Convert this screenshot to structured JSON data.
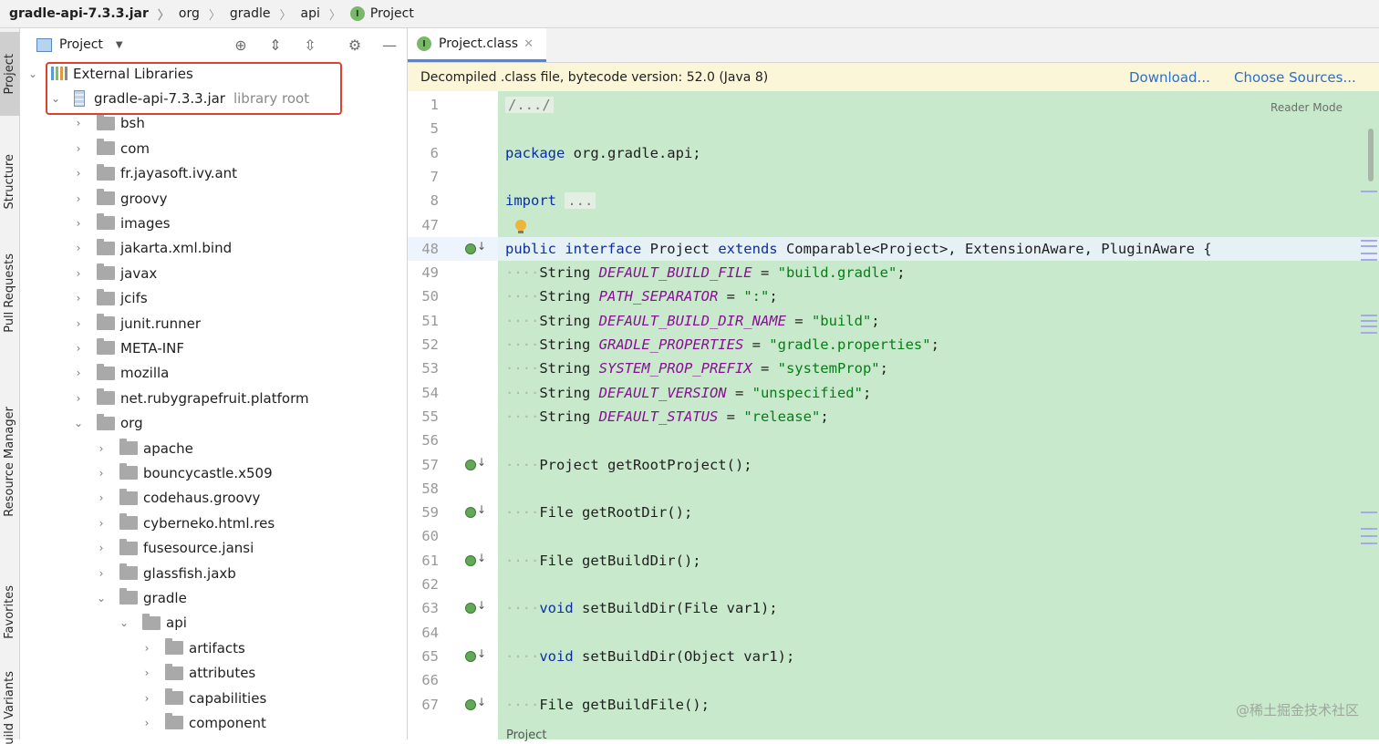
{
  "breadcrumb": [
    "gradle-api-7.3.3.jar",
    "org",
    "gradle",
    "api",
    "Project"
  ],
  "strip_tabs": [
    "Project",
    "Structure",
    "Pull Requests",
    "Resource Manager",
    "Favorites",
    "uild Variants"
  ],
  "panel": {
    "title": "Project",
    "tools": [
      "target-icon",
      "expand-all-icon",
      "collapse-all-icon",
      "gear-icon",
      "minimize-icon"
    ]
  },
  "tree": [
    {
      "label": "External Libraries",
      "depth": 0,
      "icon": "library",
      "expanded": true
    },
    {
      "label": "gradle-api-7.3.3.jar",
      "suffix": "library root",
      "depth": 1,
      "icon": "jar",
      "expanded": true
    },
    {
      "label": "bsh",
      "depth": 2,
      "icon": "folder",
      "expanded": false
    },
    {
      "label": "com",
      "depth": 2,
      "icon": "folder",
      "expanded": false
    },
    {
      "label": "fr.jayasoft.ivy.ant",
      "depth": 2,
      "icon": "folder",
      "expanded": false
    },
    {
      "label": "groovy",
      "depth": 2,
      "icon": "folder",
      "expanded": false
    },
    {
      "label": "images",
      "depth": 2,
      "icon": "folder",
      "expanded": false
    },
    {
      "label": "jakarta.xml.bind",
      "depth": 2,
      "icon": "folder",
      "expanded": false
    },
    {
      "label": "javax",
      "depth": 2,
      "icon": "folder",
      "expanded": false
    },
    {
      "label": "jcifs",
      "depth": 2,
      "icon": "folder",
      "expanded": false
    },
    {
      "label": "junit.runner",
      "depth": 2,
      "icon": "folder",
      "expanded": false
    },
    {
      "label": "META-INF",
      "depth": 2,
      "icon": "folder",
      "expanded": false
    },
    {
      "label": "mozilla",
      "depth": 2,
      "icon": "folder",
      "expanded": false
    },
    {
      "label": "net.rubygrapefruit.platform",
      "depth": 2,
      "icon": "folder",
      "expanded": false
    },
    {
      "label": "org",
      "depth": 2,
      "icon": "folder",
      "expanded": true
    },
    {
      "label": "apache",
      "depth": 3,
      "icon": "folder",
      "expanded": false
    },
    {
      "label": "bouncycastle.x509",
      "depth": 3,
      "icon": "folder",
      "expanded": false
    },
    {
      "label": "codehaus.groovy",
      "depth": 3,
      "icon": "folder",
      "expanded": false
    },
    {
      "label": "cyberneko.html.res",
      "depth": 3,
      "icon": "folder",
      "expanded": false
    },
    {
      "label": "fusesource.jansi",
      "depth": 3,
      "icon": "folder",
      "expanded": false
    },
    {
      "label": "glassfish.jaxb",
      "depth": 3,
      "icon": "folder",
      "expanded": false
    },
    {
      "label": "gradle",
      "depth": 3,
      "icon": "folder",
      "expanded": true
    },
    {
      "label": "api",
      "depth": 4,
      "icon": "folder",
      "expanded": true
    },
    {
      "label": "artifacts",
      "depth": 5,
      "icon": "folder",
      "expanded": false
    },
    {
      "label": "attributes",
      "depth": 5,
      "icon": "folder",
      "expanded": false
    },
    {
      "label": "capabilities",
      "depth": 5,
      "icon": "folder",
      "expanded": false
    },
    {
      "label": "component",
      "depth": 5,
      "icon": "folder",
      "expanded": false
    }
  ],
  "editor": {
    "tab_label": "Project.class",
    "tab_badge": "I",
    "notice": "Decompiled .class file, bytecode version: 52.0 (Java 8)",
    "download_link": "Download...",
    "sources_link": "Choose Sources...",
    "reader_mode": "Reader Mode",
    "footer_crumb": "Project",
    "watermark": "@稀土掘金技术社区",
    "lines": [
      {
        "n": "1",
        "segs": [
          [
            "fold",
            "/.../"
          ]
        ]
      },
      {
        "n": "5",
        "segs": []
      },
      {
        "n": "6",
        "segs": [
          [
            "kw",
            "package"
          ],
          [
            "",
            " org.gradle.api;"
          ]
        ]
      },
      {
        "n": "7",
        "segs": []
      },
      {
        "n": "8",
        "segs": [
          [
            "kw",
            "import"
          ],
          [
            "",
            " "
          ],
          [
            "fold",
            "..."
          ]
        ]
      },
      {
        "n": "47",
        "segs": [],
        "bulb": true
      },
      {
        "n": "48",
        "segs": [
          [
            "kw",
            "public interface"
          ],
          [
            "",
            " Project "
          ],
          [
            "kw",
            "extends"
          ],
          [
            "",
            " Comparable<Project>, ExtensionAware, PluginAware {"
          ]
        ],
        "marker": true,
        "highlight": true
      },
      {
        "n": "49",
        "segs": [
          [
            "dots",
            "····"
          ],
          [
            "",
            "String "
          ],
          [
            "cn",
            "DEFAULT_BUILD_FILE"
          ],
          [
            "",
            " = "
          ],
          [
            "st",
            "\"build.gradle\""
          ],
          [
            "",
            ";"
          ]
        ]
      },
      {
        "n": "50",
        "segs": [
          [
            "dots",
            "····"
          ],
          [
            "",
            "String "
          ],
          [
            "cn",
            "PATH_SEPARATOR"
          ],
          [
            "",
            " = "
          ],
          [
            "st",
            "\":\""
          ],
          [
            "",
            ";"
          ]
        ]
      },
      {
        "n": "51",
        "segs": [
          [
            "dots",
            "····"
          ],
          [
            "",
            "String "
          ],
          [
            "cn",
            "DEFAULT_BUILD_DIR_NAME"
          ],
          [
            "",
            " = "
          ],
          [
            "st",
            "\"build\""
          ],
          [
            "",
            ";"
          ]
        ]
      },
      {
        "n": "52",
        "segs": [
          [
            "dots",
            "····"
          ],
          [
            "",
            "String "
          ],
          [
            "cn",
            "GRADLE_PROPERTIES"
          ],
          [
            "",
            " = "
          ],
          [
            "st",
            "\"gradle.properties\""
          ],
          [
            "",
            ";"
          ]
        ]
      },
      {
        "n": "53",
        "segs": [
          [
            "dots",
            "····"
          ],
          [
            "",
            "String "
          ],
          [
            "cn",
            "SYSTEM_PROP_PREFIX"
          ],
          [
            "",
            " = "
          ],
          [
            "st",
            "\"systemProp\""
          ],
          [
            "",
            ";"
          ]
        ]
      },
      {
        "n": "54",
        "segs": [
          [
            "dots",
            "····"
          ],
          [
            "",
            "String "
          ],
          [
            "cn",
            "DEFAULT_VERSION"
          ],
          [
            "",
            " = "
          ],
          [
            "st",
            "\"unspecified\""
          ],
          [
            "",
            ";"
          ]
        ]
      },
      {
        "n": "55",
        "segs": [
          [
            "dots",
            "····"
          ],
          [
            "",
            "String "
          ],
          [
            "cn",
            "DEFAULT_STATUS"
          ],
          [
            "",
            " = "
          ],
          [
            "st",
            "\"release\""
          ],
          [
            "",
            ";"
          ]
        ]
      },
      {
        "n": "56",
        "segs": []
      },
      {
        "n": "57",
        "segs": [
          [
            "dots",
            "····"
          ],
          [
            "",
            "Project getRootProject();"
          ]
        ],
        "marker": true
      },
      {
        "n": "58",
        "segs": []
      },
      {
        "n": "59",
        "segs": [
          [
            "dots",
            "····"
          ],
          [
            "",
            "File getRootDir();"
          ]
        ],
        "marker": true
      },
      {
        "n": "60",
        "segs": []
      },
      {
        "n": "61",
        "segs": [
          [
            "dots",
            "····"
          ],
          [
            "",
            "File getBuildDir();"
          ]
        ],
        "marker": true
      },
      {
        "n": "62",
        "segs": []
      },
      {
        "n": "63",
        "segs": [
          [
            "dots",
            "····"
          ],
          [
            "kw",
            "void"
          ],
          [
            "",
            " setBuildDir(File var1);"
          ]
        ],
        "marker": true
      },
      {
        "n": "64",
        "segs": []
      },
      {
        "n": "65",
        "segs": [
          [
            "dots",
            "····"
          ],
          [
            "kw",
            "void"
          ],
          [
            "",
            " setBuildDir(Object var1);"
          ]
        ],
        "marker": true
      },
      {
        "n": "66",
        "segs": []
      },
      {
        "n": "67",
        "segs": [
          [
            "dots",
            "····"
          ],
          [
            "",
            "File getBuildFile();"
          ]
        ],
        "marker": true
      }
    ]
  }
}
